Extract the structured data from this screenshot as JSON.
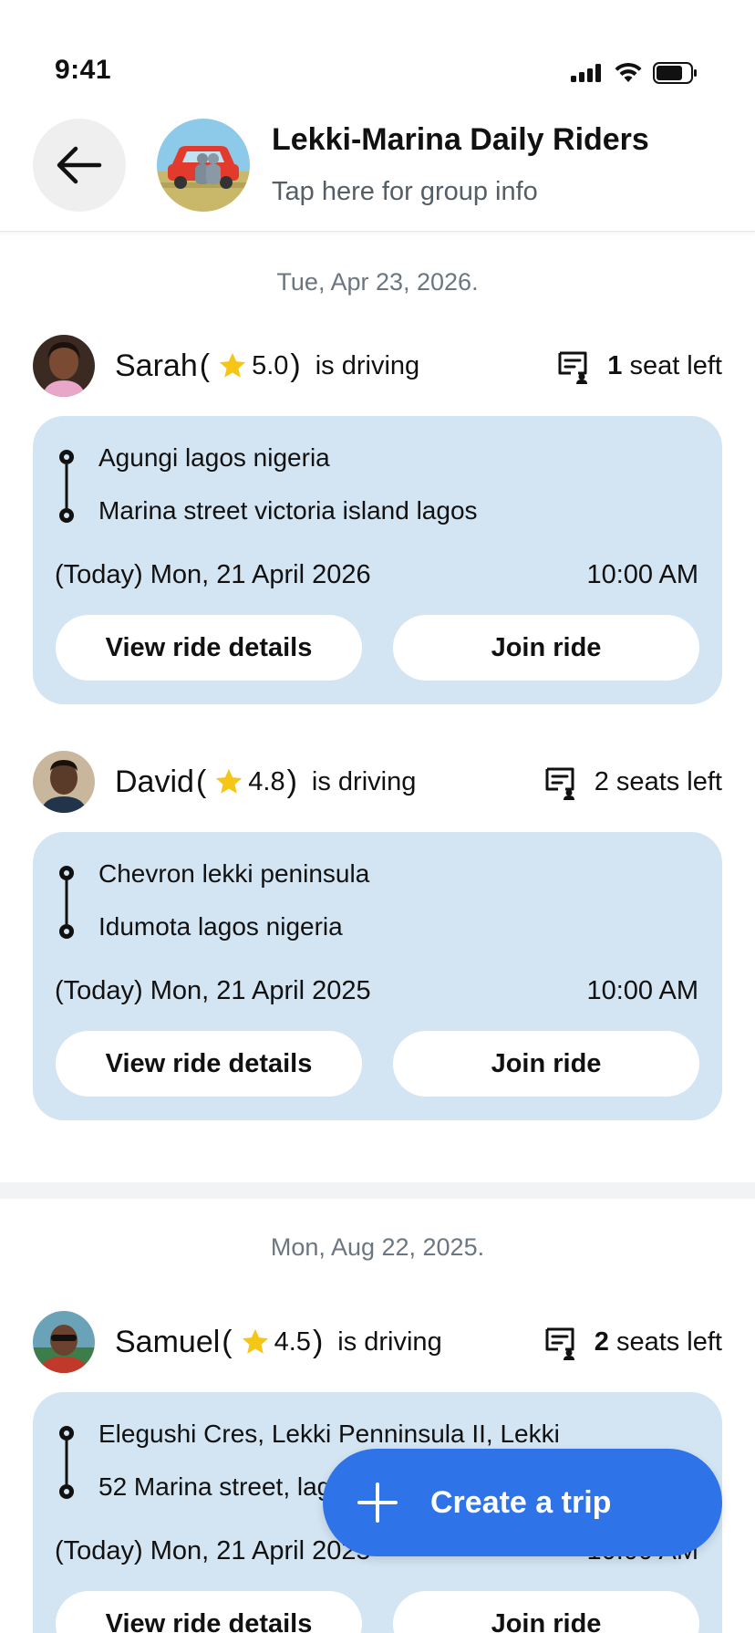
{
  "status_bar": {
    "time": "9:41"
  },
  "header": {
    "title": "Lekki-Marina Daily Riders",
    "subtitle": "Tap here for group info"
  },
  "sections": [
    {
      "date": "Tue, Apr 23, 2026.",
      "rides": [
        {
          "driver": "Sarah",
          "rating": "5.0",
          "status": "is driving",
          "seats_count": "1",
          "seats_label": "seat left",
          "from": "Agungi lagos nigeria",
          "to": "Marina street victoria island lagos",
          "date": "(Today) Mon, 21 April 2026",
          "time": "10:00 AM",
          "view_label": "View ride details",
          "join_label": "Join ride"
        },
        {
          "driver": "David",
          "rating": "4.8",
          "status": "is driving",
          "seats_count": "2 seats left",
          "seats_label": "",
          "from": "Chevron lekki peninsula",
          "to": "Idumota lagos nigeria",
          "date": "(Today) Mon, 21 April 2025",
          "time": "10:00 AM",
          "view_label": "View ride details",
          "join_label": "Join ride"
        }
      ]
    },
    {
      "date": "Mon, Aug 22, 2025.",
      "rides": [
        {
          "driver": "Samuel",
          "rating": "4.5",
          "status": "is driving",
          "seats_count": "2",
          "seats_label": "seats left",
          "from": "Elegushi Cres, Lekki Penninsula II, Lekki",
          "to": "52 Marina street, lagos",
          "date": "(Today) Mon, 21 April 2025",
          "time": "10:00 AM",
          "view_label": "View ride details",
          "join_label": "Join ride"
        }
      ]
    }
  ],
  "fab": {
    "label": "Create a trip"
  },
  "colors": {
    "card": "#d3e4f2",
    "primary": "#2f73e8",
    "star": "#f5c518"
  }
}
